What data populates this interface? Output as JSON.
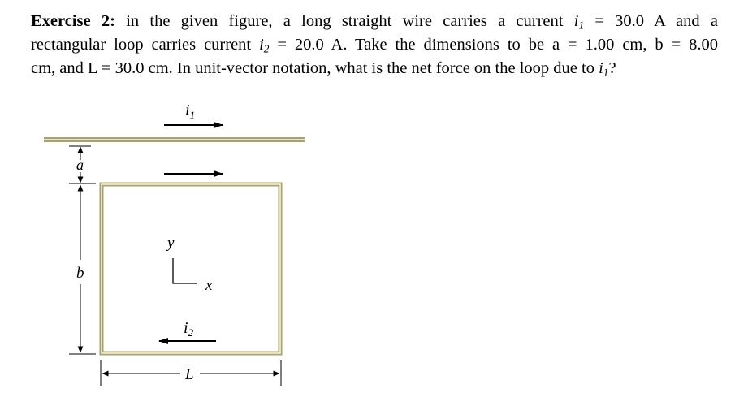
{
  "problem": {
    "heading": "Exercise 2:",
    "line1": [
      {
        "t": " in the given figure, a long straight wire carries a current "
      },
      {
        "t": "i",
        "italic": true
      },
      {
        "t": "1",
        "sub": true,
        "italic": true
      },
      {
        "t": " = 30.0 A and a"
      }
    ],
    "line2": [
      {
        "t": "rectangular loop carries current "
      },
      {
        "t": "i",
        "italic": true
      },
      {
        "t": "2",
        "sub": true,
        "italic": true
      },
      {
        "t": " = 20.0 A. Take the dimensions to be a = 1.00 cm, b = 8.00"
      }
    ],
    "line3": [
      {
        "t": "cm, and L = 30.0 cm. In unit-vector notation, what is the net force on the loop due to "
      },
      {
        "t": "i",
        "italic": true
      },
      {
        "t": "1",
        "sub": true,
        "italic": true
      },
      {
        "t": "?"
      }
    ]
  },
  "figure": {
    "wire_current_label": "i",
    "wire_current_sub": "1",
    "loop_current_label": "i",
    "loop_current_sub": "2",
    "dim_a_label": "a",
    "dim_b_label": "b",
    "dim_L_label": "L",
    "axis_y_label": "y",
    "axis_x_label": "x",
    "colors": {
      "wire": "#a9a26a",
      "wire_inner": "#e8e4c8",
      "loop": "#a9a26a",
      "loop_inner": "#f3efd8",
      "ink": "#000000"
    }
  }
}
